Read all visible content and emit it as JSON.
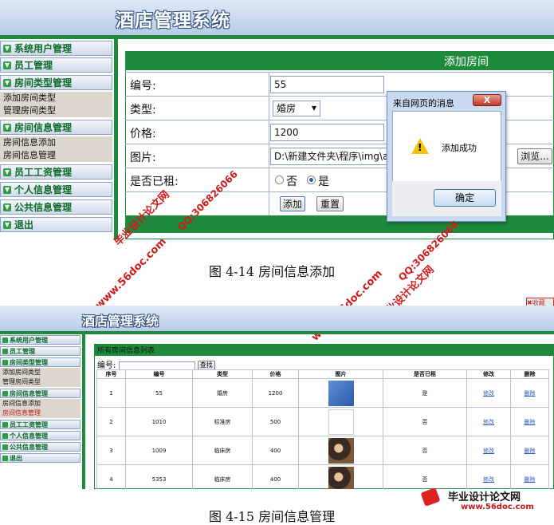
{
  "fig1": {
    "system_title": "酒店管理系统",
    "menu": [
      {
        "label": "系统用户管理"
      },
      {
        "label": "员工管理"
      },
      {
        "label": "房间类型管理",
        "subs": [
          "添加房间类型",
          "管理房间类型"
        ]
      },
      {
        "label": "房间信息管理",
        "subs": [
          "房间信息添加",
          "房间信息管理"
        ]
      },
      {
        "label": "员工工资管理"
      },
      {
        "label": "个人信息管理"
      },
      {
        "label": "公共信息管理"
      },
      {
        "label": "退出"
      }
    ],
    "form_title": "添加房间",
    "fields": {
      "number_label": "编号:",
      "number_value": "55",
      "type_label": "类型:",
      "type_value": "婚房",
      "price_label": "价格:",
      "price_value": "1200",
      "image_label": "图片:",
      "image_value": "D:\\新建文件夹\\程序\\img\\ad",
      "browse_label": "浏览...",
      "rented_label": "是否已租:",
      "rented_no": "否",
      "rented_yes": "是"
    },
    "buttons": {
      "add": "添加",
      "reset": "重置"
    },
    "dialog": {
      "title": "来自网页的消息",
      "close": "X",
      "message": "添加成功",
      "ok": "确定"
    },
    "caption": "图 4-14 房间信息添加"
  },
  "fig2": {
    "system_title": "酒店管理系统",
    "menu": [
      {
        "label": "系统用户管理"
      },
      {
        "label": "员工管理"
      },
      {
        "label": "房间类型管理",
        "subs": [
          "添加房间类型",
          "管理房间类型"
        ]
      },
      {
        "label": "房间信息管理",
        "subs": [
          "房间信息添加",
          "房间信息管理"
        ]
      },
      {
        "label": "员工工资管理"
      },
      {
        "label": "个人信息管理"
      },
      {
        "label": "公共信息管理"
      },
      {
        "label": "退出"
      }
    ],
    "list_title": "所有房间信息列表",
    "search_label": "编号:",
    "search_button": "查找",
    "columns": [
      "序号",
      "编号",
      "类型",
      "价格",
      "图片",
      "是否已租",
      "修改",
      "删除"
    ],
    "rows": [
      {
        "seq": "1",
        "num": "55",
        "type": "婚房",
        "price": "1200",
        "img": "blue",
        "rented": "是",
        "edit": "修改",
        "del": "删除"
      },
      {
        "seq": "2",
        "num": "1010",
        "type": "标准房",
        "price": "500",
        "img": "blank",
        "rented": "否",
        "edit": "修改",
        "del": "删除"
      },
      {
        "seq": "3",
        "num": "1009",
        "type": "临床房",
        "price": "400",
        "img": "photo",
        "rented": "否",
        "edit": "修改",
        "del": "删除"
      },
      {
        "seq": "4",
        "num": "5353",
        "type": "临床房",
        "price": "400",
        "img": "photo",
        "rented": "否",
        "edit": "修改",
        "del": "删除"
      }
    ],
    "caption": "图 4-15 房间信息管理",
    "corner_tag": "收藏"
  },
  "watermarks": {
    "site": "www.56doc.com",
    "qq": "QQ:306826066",
    "brand": "毕业设计论文网",
    "logo_text": "毕业设计论文网",
    "logo_url": "www.56doc.com"
  },
  "colors": {
    "green": "#1e8a3c",
    "watermark_red": "#d11a1a",
    "link": "#2b57c9"
  }
}
